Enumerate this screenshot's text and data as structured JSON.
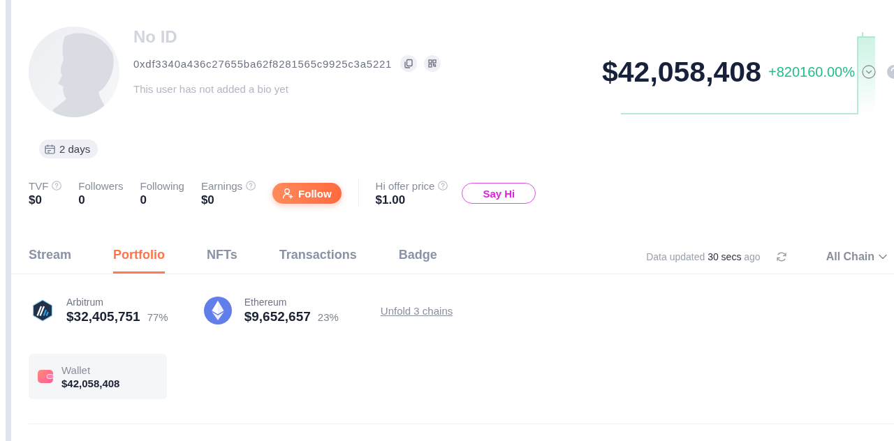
{
  "profile": {
    "name": "No ID",
    "address": "0xdf3340a436c27655ba62f8281565c9925c3a5221",
    "bio": "This user has not added a bio yet",
    "account_age": "2 days"
  },
  "net_worth": {
    "value": "$42,058,408",
    "change": "+820160.00%"
  },
  "stats": [
    {
      "label": "TVF",
      "value": "$0",
      "help": true
    },
    {
      "label": "Followers",
      "value": "0",
      "help": false
    },
    {
      "label": "Following",
      "value": "0",
      "help": false
    },
    {
      "label": "Earnings",
      "value": "$0",
      "help": true
    }
  ],
  "follow_button": {
    "label": "Follow"
  },
  "hi_offer": {
    "label": "Hi offer price",
    "value": "$1.00",
    "help": true
  },
  "say_hi_button": {
    "label": "Say Hi"
  },
  "tabs": [
    {
      "label": "Stream",
      "selected": false
    },
    {
      "label": "Portfolio",
      "selected": true
    },
    {
      "label": "NFTs",
      "selected": false
    },
    {
      "label": "Transactions",
      "selected": false
    },
    {
      "label": "Badge",
      "selected": false
    }
  ],
  "data_updated": "Data updated **30 secs** ago",
  "chain_filter": {
    "label": "All Chain"
  },
  "chains": [
    {
      "kind": "arbitrum",
      "name": "Arbitrum",
      "value": "$32,405,751",
      "share": "77%"
    },
    {
      "kind": "ethereum",
      "name": "Ethereum",
      "value": "$9,652,657",
      "share": "23%"
    }
  ],
  "unfold_link": "Unfold 3 chains",
  "wallet": {
    "label": "Wallet",
    "value": "$42,058,408"
  }
}
